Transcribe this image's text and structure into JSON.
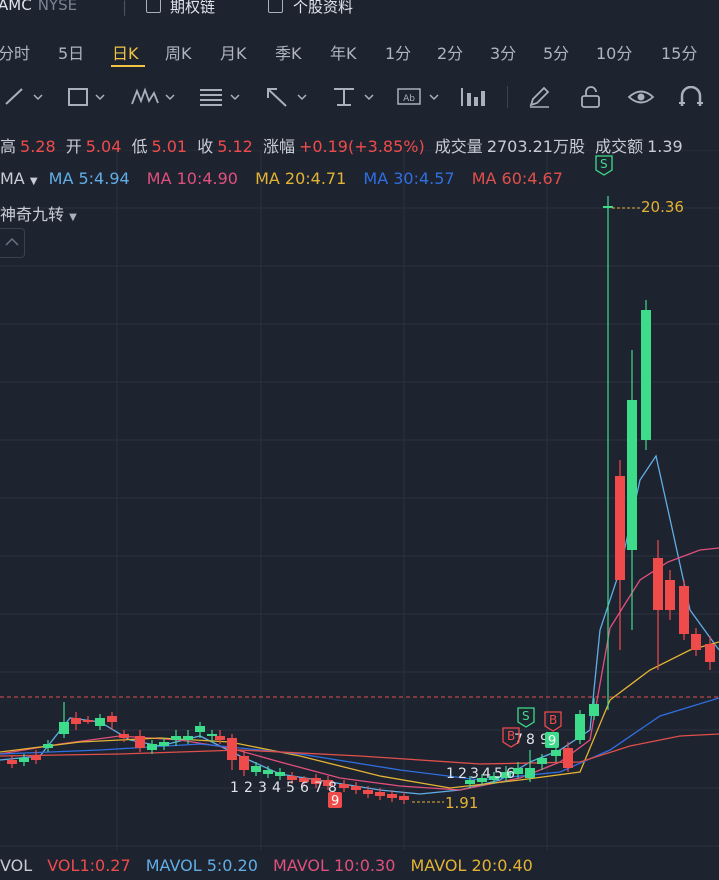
{
  "header": {
    "symbol": "AMC",
    "exchange": "NYSE",
    "nav": [
      {
        "label": "期权链",
        "icon": "options-chain-icon"
      },
      {
        "label": "个股资料",
        "icon": "stock-profile-icon"
      }
    ]
  },
  "periods": {
    "items": [
      "分时",
      "5日",
      "日K",
      "周K",
      "月K",
      "季K",
      "年K",
      "1分",
      "2分",
      "3分",
      "5分",
      "10分",
      "15分"
    ],
    "active": "日K"
  },
  "toolbar": {
    "tools": [
      "line-draw-icon",
      "rectangle-icon",
      "pattern-icon",
      "fibonacci-icon",
      "arrow-icon",
      "price-range-icon",
      "text-label-icon",
      "bar-chart-icon",
      "pencil-icon",
      "lock-icon",
      "eye-icon",
      "magnet-icon"
    ]
  },
  "quote": {
    "high_label": "高",
    "high": "5.28",
    "open_label": "开",
    "open": "5.04",
    "low_label": "低",
    "low": "5.01",
    "close_label": "收",
    "close": "5.12",
    "change_label": "涨幅",
    "change": "+0.19(+3.85%)",
    "volume_label": "成交量",
    "volume": "2703.21万股",
    "turnover_label": "成交额",
    "turnover": "1.39"
  },
  "ma": {
    "label": "MA",
    "items": [
      {
        "text": "MA 5:4.94",
        "color": "#61aee6"
      },
      {
        "text": "MA 10:4.90",
        "color": "#e0507c"
      },
      {
        "text": "MA 20:4.71",
        "color": "#e3b333"
      },
      {
        "text": "MA 30:4.57",
        "color": "#2f6fe0"
      },
      {
        "text": "MA 60:4.67",
        "color": "#e0504a"
      }
    ]
  },
  "indicator": {
    "label": "神奇九转"
  },
  "chart_data": {
    "type": "candlestick",
    "annotations": {
      "max_label": "20.36",
      "min_label": "1.91",
      "reference_line": 5.12
    },
    "nine_turn_labels": {
      "down_seq_1": [
        "1",
        "2",
        "3",
        "4",
        "5",
        "6",
        "7",
        "8",
        "9"
      ],
      "up_seq": [
        "1",
        "2",
        "3",
        "4",
        "5",
        "6",
        "7",
        "8",
        "9"
      ]
    },
    "colors": {
      "up": "#3ddc8a",
      "down": "#ef4b4b"
    }
  },
  "volume": {
    "label": "VOL",
    "items": [
      {
        "text": "VOL1:0.27",
        "color": "#ef4b4b"
      },
      {
        "text": "MAVOL 5:0.20",
        "color": "#61aee6"
      },
      {
        "text": "MAVOL 10:0.30",
        "color": "#e0507c"
      },
      {
        "text": "MAVOL 20:0.40",
        "color": "#e3b333"
      }
    ]
  }
}
